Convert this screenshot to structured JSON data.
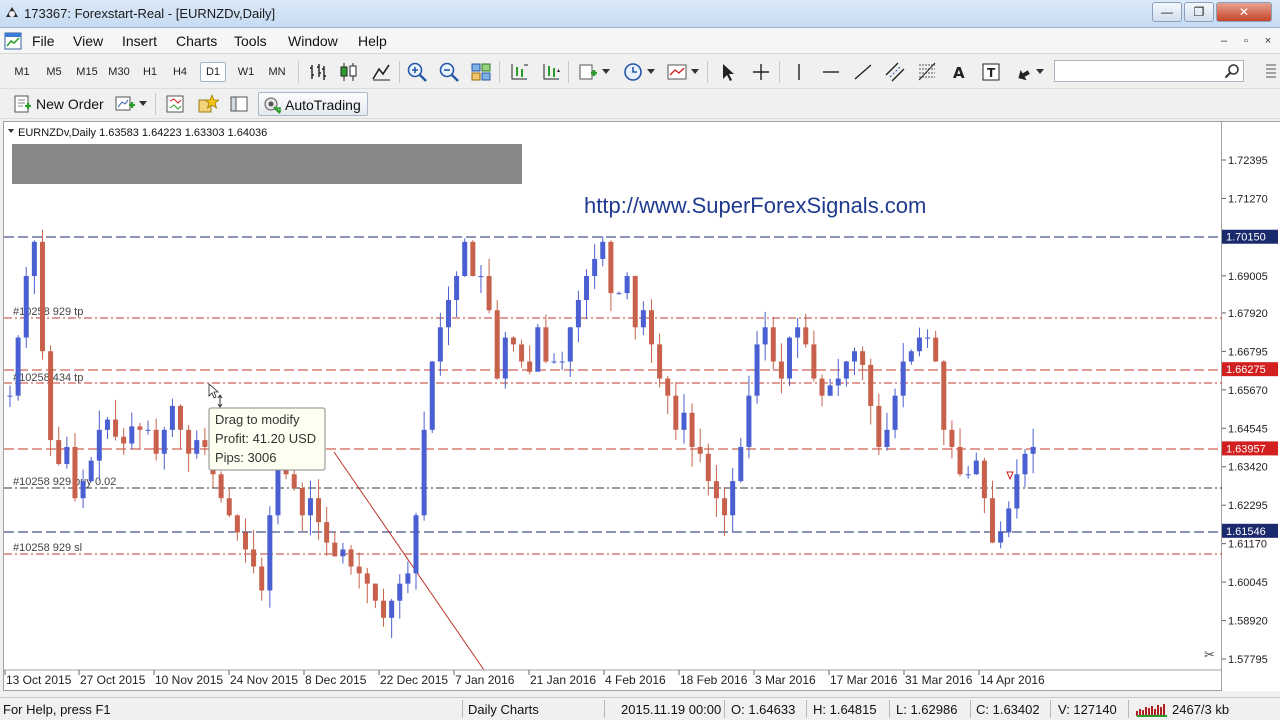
{
  "window": {
    "title": "173367: Forexstart-Real - [EURNZDv,Daily]",
    "controls": [
      "—",
      "❐",
      "✕"
    ]
  },
  "menu": {
    "items": [
      "File",
      "View",
      "Insert",
      "Charts",
      "Tools",
      "Window",
      "Help"
    ],
    "mdi_controls": [
      "–",
      "▫",
      "×"
    ]
  },
  "timeframes": [
    "M1",
    "M5",
    "M15",
    "M30",
    "H1",
    "H4",
    "D1",
    "W1",
    "MN"
  ],
  "active_timeframe": "D1",
  "search": {
    "value": "",
    "placeholder": ""
  },
  "toolbar2": {
    "new_order": "New Order",
    "autotrading": "AutoTrading"
  },
  "chart": {
    "header": "EURNZDv,Daily  1.63583 1.64223 1.63303 1.64036",
    "watermark": "http://www.SuperForexSignals.com",
    "price_axis": [
      "1.72395",
      "1.71270",
      "1.70150",
      "1.69005",
      "1.67920",
      "1.66795",
      "1.66275",
      "1.65670",
      "1.64545",
      "1.63957",
      "1.63420",
      "1.62295",
      "1.61546",
      "1.61170",
      "1.60045",
      "1.58920",
      "1.57795"
    ],
    "date_axis": [
      "13 Oct 2015",
      "27 Oct 2015",
      "10 Nov 2015",
      "24 Nov 2015",
      "8 Dec 2015",
      "22 Dec 2015",
      "7 Jan 2016",
      "21 Jan 2016",
      "4 Feb 2016",
      "18 Feb 2016",
      "3 Mar 2016",
      "17 Mar 2016",
      "31 Mar 2016",
      "14 Apr 2016"
    ],
    "level_labels": [
      "#10258 929 tp",
      "#10258 434 tp",
      "#10258 929 buy 0.02",
      "#10258 929 sl"
    ],
    "price_tags": [
      {
        "price": "1.70150",
        "color": "#1a2a6c"
      },
      {
        "price": "1.66275",
        "color": "#d21f1f"
      },
      {
        "price": "1.63957",
        "color": "#d21f1f"
      },
      {
        "price": "1.61546",
        "color": "#1a2a6c"
      }
    ],
    "tooltip": {
      "line1": "Drag to modify",
      "line2": "Profit: 41.20 USD",
      "line3": "Pips: 3006"
    },
    "bull_color": "#4a5fd1",
    "bear_color": "#c8614c"
  },
  "status": {
    "help": "For Help, press F1",
    "profile": "Daily Charts",
    "datetime": "2015.11.19 00:00",
    "open": "O: 1.64633",
    "high": "H: 1.64815",
    "low": "L: 1.62986",
    "close": "C: 1.63402",
    "volume": "V: 127140",
    "traffic": "2467/3 kb"
  }
}
